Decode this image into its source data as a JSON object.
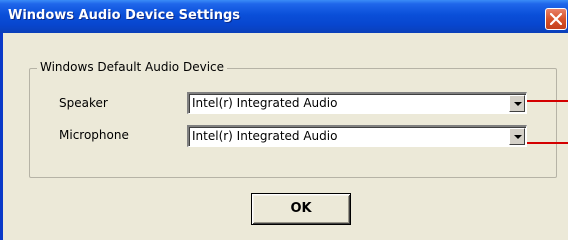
{
  "window": {
    "title": "Windows Audio Device Settings"
  },
  "group": {
    "legend": "Windows Default Audio Device"
  },
  "speaker": {
    "label": "Speaker",
    "selected": "Intel(r) Integrated Audio"
  },
  "microphone": {
    "label": "Microphone",
    "selected": "Intel(r) Integrated Audio"
  },
  "buttons": {
    "ok_label": "OK"
  },
  "icons": {
    "close": "close-icon",
    "dropdown": "chevron-down-icon"
  },
  "colors": {
    "titlebar": "#0a4fd9",
    "window_bg": "#ece9d8",
    "close_button": "#d8532b",
    "annotation_line": "#d40000"
  }
}
